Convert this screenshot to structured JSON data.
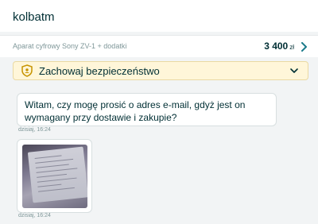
{
  "header": {
    "username": "kolbatm"
  },
  "offer": {
    "title": "Aparat cyfrowy Sony ZV-1 + dodatki",
    "price": "3 400",
    "currency": "zł",
    "chevron_icon": "chevron-right-icon"
  },
  "safety": {
    "label": "Zachowaj bezpieczeństwo",
    "icon": "shield-icon",
    "toggle_icon": "chevron-down-icon"
  },
  "messages": [
    {
      "text": "Witam, czy mogę prosić o adres e-mail, gdyż jest on wymagany przy dostawie i zakupie?",
      "time": "dzisiaj, 16:24"
    },
    {
      "type": "image",
      "time": "dzisiaj, 16:24"
    }
  ],
  "colors": {
    "accent": "#002f34",
    "warning_bg": "#fff6d9",
    "muted": "#7f9799"
  }
}
